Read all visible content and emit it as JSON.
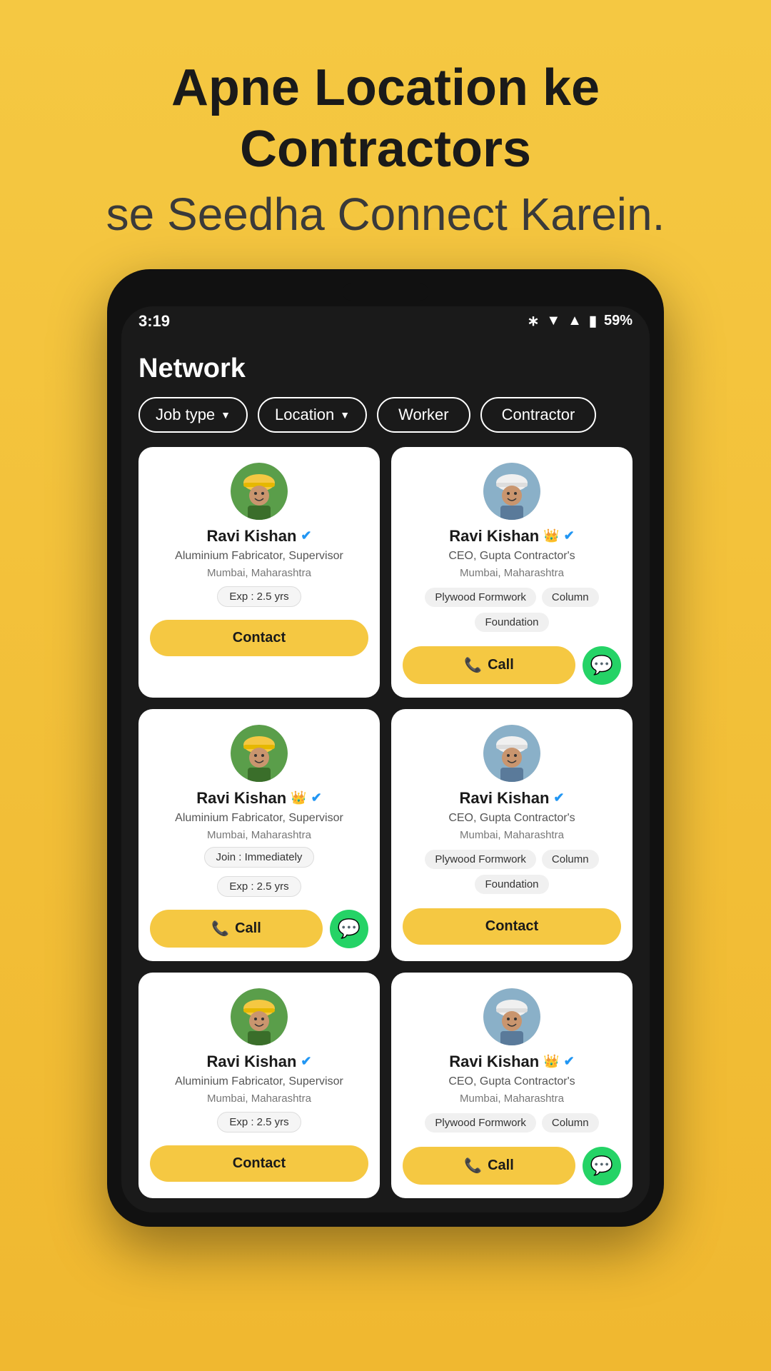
{
  "hero": {
    "line1_plain": "Apne",
    "line1_bold1": "Location",
    "line1_mid": "ke",
    "line1_bold2": "Contractors",
    "line2": "se Seedha Connect Karein."
  },
  "status_bar": {
    "time": "3:19",
    "battery": "59%"
  },
  "page_title": "Network",
  "filters": {
    "job_type": "Job type",
    "location": "Location",
    "worker": "Worker",
    "contractor": "Contractor"
  },
  "cards": [
    {
      "id": "card-1",
      "type": "worker",
      "name": "Ravi Kishan",
      "verified": true,
      "crown": false,
      "role": "Aluminium Fabricator, Supervisor",
      "location": "Mumbai, Maharashtra",
      "exp": "Exp : 2.5 yrs",
      "join": null,
      "tags": [],
      "action": "contact"
    },
    {
      "id": "card-2",
      "type": "contractor",
      "name": "Ravi Kishan",
      "verified": true,
      "crown": true,
      "role": "CEO, Gupta Contractor's",
      "location": "Mumbai, Maharashtra",
      "exp": null,
      "join": null,
      "tags": [
        "Plywood Formwork",
        "Column",
        "Foundation"
      ],
      "action": "call-whatsapp"
    },
    {
      "id": "card-3",
      "type": "worker",
      "name": "Ravi Kishan",
      "verified": true,
      "crown": true,
      "role": "Aluminium Fabricator, Supervisor",
      "location": "Mumbai, Maharashtra",
      "exp": "Exp : 2.5 yrs",
      "join": "Join : Immediately",
      "tags": [],
      "action": "call-whatsapp"
    },
    {
      "id": "card-4",
      "type": "contractor",
      "name": "Ravi Kishan",
      "verified": true,
      "crown": false,
      "role": "CEO, Gupta Contractor's",
      "location": "Mumbai, Maharashtra",
      "exp": null,
      "join": null,
      "tags": [
        "Plywood Formwork",
        "Column",
        "Foundation"
      ],
      "action": "contact"
    },
    {
      "id": "card-5",
      "type": "worker",
      "name": "Ravi Kishan",
      "verified": true,
      "crown": false,
      "role": "Aluminium Fabricator, Supervisor",
      "location": "Mumbai, Maharashtra",
      "exp": "Exp : 2.5 yrs",
      "join": null,
      "tags": [],
      "action": "contact"
    },
    {
      "id": "card-6",
      "type": "contractor",
      "name": "Ravi Kishan",
      "verified": true,
      "crown": true,
      "role": "CEO, Gupta Contractor's",
      "location": "Mumbai, Maharashtra",
      "exp": null,
      "join": null,
      "tags": [
        "Plywood Formwork",
        "Column"
      ],
      "action": "call-whatsapp"
    }
  ],
  "labels": {
    "contact": "Contact",
    "call": "Call",
    "whatsapp_icon": "💬"
  }
}
